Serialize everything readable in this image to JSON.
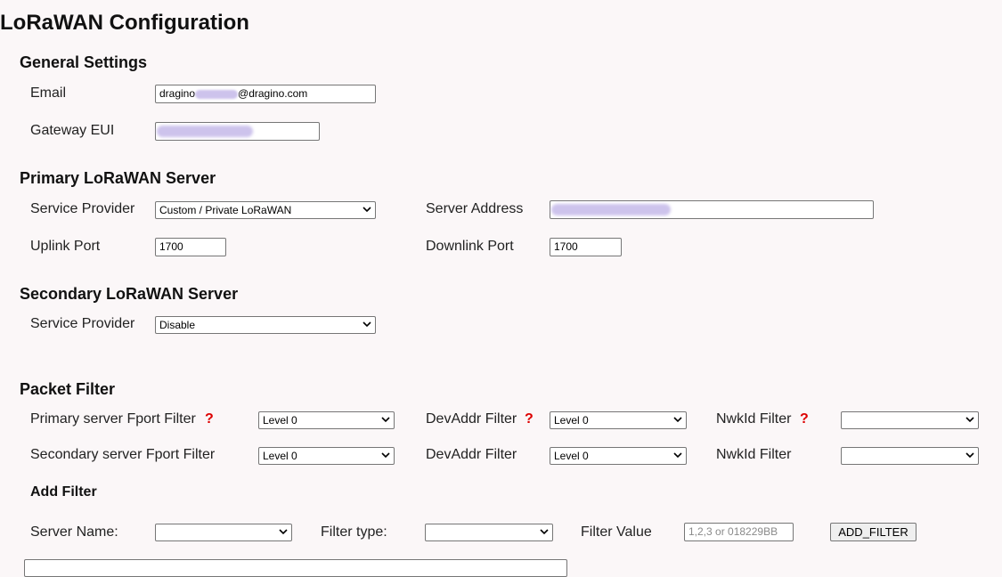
{
  "page": {
    "title": "LoRaWAN Configuration"
  },
  "general": {
    "heading": "General Settings",
    "email_label": "Email",
    "email_prefix": "dragino",
    "email_suffix": "@dragino.com",
    "gateway_eui_label": "Gateway EUI"
  },
  "primary": {
    "heading": "Primary LoRaWAN Server",
    "service_provider_label": "Service Provider",
    "service_provider_value": "Custom / Private LoRaWAN",
    "server_address_label": "Server Address",
    "uplink_port_label": "Uplink Port",
    "uplink_port_value": "1700",
    "downlink_port_label": "Downlink Port",
    "downlink_port_value": "1700"
  },
  "secondary": {
    "heading": "Secondary LoRaWAN Server",
    "service_provider_label": "Service Provider",
    "service_provider_value": "Disable"
  },
  "packet_filter": {
    "heading": "Packet Filter",
    "help_mark": "?",
    "primary_fport_label": "Primary server Fport Filter",
    "primary_fport_value": "Level 0",
    "primary_devaddr_label": "DevAddr Filter",
    "primary_devaddr_value": "Level 0",
    "primary_nwkid_label": "NwkId Filter",
    "primary_nwkid_value": "",
    "secondary_fport_label": "Secondary server Fport Filter",
    "secondary_fport_value": "Level 0",
    "secondary_devaddr_label": "DevAddr Filter",
    "secondary_devaddr_value": "Level 0",
    "secondary_nwkid_label": "NwkId Filter",
    "secondary_nwkid_value": ""
  },
  "add_filter": {
    "heading": "Add Filter",
    "server_name_label": "Server Name:",
    "server_name_value": "",
    "filter_type_label": "Filter type:",
    "filter_type_value": "",
    "filter_value_label": "Filter Value",
    "filter_value_placeholder": "1,2,3 or 018229BB",
    "button_label": "ADD_FILTER"
  },
  "icons": {
    "select_arrow": "chevron-down-icon",
    "help": "help-icon"
  },
  "colors": {
    "background": "#fbf7f8",
    "help_mark": "#dd0000",
    "redaction": "#cdc3ec"
  }
}
